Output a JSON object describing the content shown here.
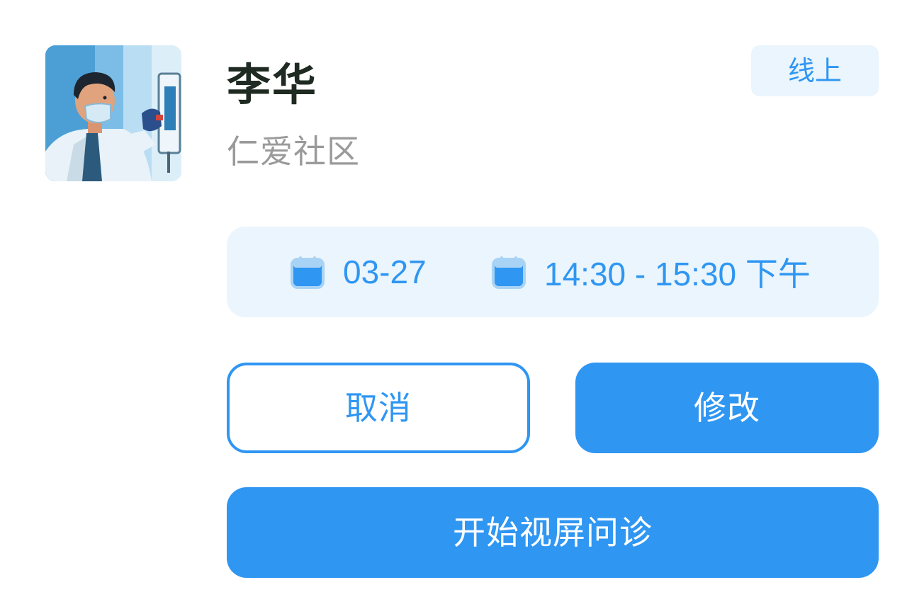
{
  "doctor": {
    "name": "李华",
    "community": "仁爱社区"
  },
  "badge": {
    "label": "线上"
  },
  "schedule": {
    "date": "03-27",
    "time_range": "14:30 - 15:30 下午",
    "icon": "calendar-icon"
  },
  "actions": {
    "cancel_label": "取消",
    "modify_label": "修改",
    "video_label": "开始视屏问诊"
  },
  "colors": {
    "accent": "#2f96f2",
    "accent_light": "#eaf5fd",
    "name_text": "#1f2a22",
    "muted_text": "#9a9a9a"
  }
}
